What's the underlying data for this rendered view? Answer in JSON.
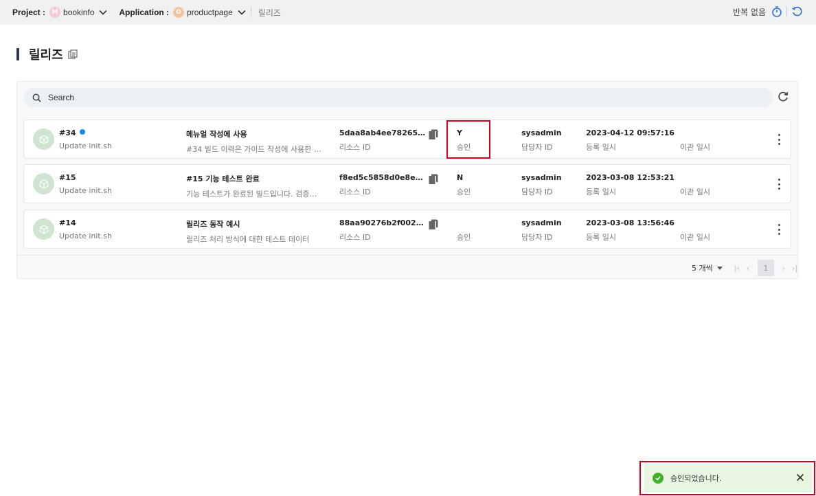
{
  "topbar": {
    "project_label": "Project :",
    "project_badge": "M",
    "project_value": "bookinfo",
    "application_label": "Application :",
    "application_badge": "O",
    "application_value": "productpage",
    "breadcrumb": "릴리즈",
    "repeat_label": "반복 없음"
  },
  "page": {
    "title": "릴리즈"
  },
  "search": {
    "placeholder": "Search"
  },
  "rows": [
    {
      "number": "#34",
      "new": true,
      "commit": "Update init.sh",
      "name": "메뉴얼 작성에 사용",
      "desc": "#34 빌드 이력은 가이드 작성에 사용한 릴리…",
      "resource_id": "5daa8ab4ee78265a4ea…",
      "resource_label": "리소스 ID",
      "approval": "Y",
      "approval_label": "승인",
      "owner": "sysadmin",
      "owner_label": "담당자 ID",
      "registered": "2023-04-12 09:57:16",
      "registered_label": "등록 일시",
      "migrated_label": "이관 일시"
    },
    {
      "number": "#15",
      "new": false,
      "commit": "Update init.sh",
      "name": "#15 기능 테스트 완료",
      "desc": "기능 테스트가 완료된 빌드입니다. 검증계에…",
      "resource_id": "f8ed5c5858d0e8eff6f5…",
      "resource_label": "리소스 ID",
      "approval": "N",
      "approval_label": "승인",
      "owner": "sysadmin",
      "owner_label": "담당자 ID",
      "registered": "2023-03-08 12:53:21",
      "registered_label": "등록 일시",
      "migrated_label": "이관 일시"
    },
    {
      "number": "#14",
      "new": false,
      "commit": "Update init.sh",
      "name": "릴리즈 동작 예시",
      "desc": "릴리즈 처리 방식에 대한 테스트 데이터",
      "resource_id": "88aa90276b2f00290d3f…",
      "resource_label": "리소스 ID",
      "approval": "",
      "approval_label": "승인",
      "owner": "sysadmin",
      "owner_label": "담당자 ID",
      "registered": "2023-03-08 13:56:46",
      "registered_label": "등록 일시",
      "migrated_label": "이관 일시"
    }
  ],
  "pagination": {
    "page_size": "5 개씩",
    "current_page": "1"
  },
  "toast": {
    "message": "승인되었습니다."
  },
  "colors": {
    "highlight": "#d0021b",
    "new_dot": "#1e88e5",
    "success": "#43b02a"
  }
}
